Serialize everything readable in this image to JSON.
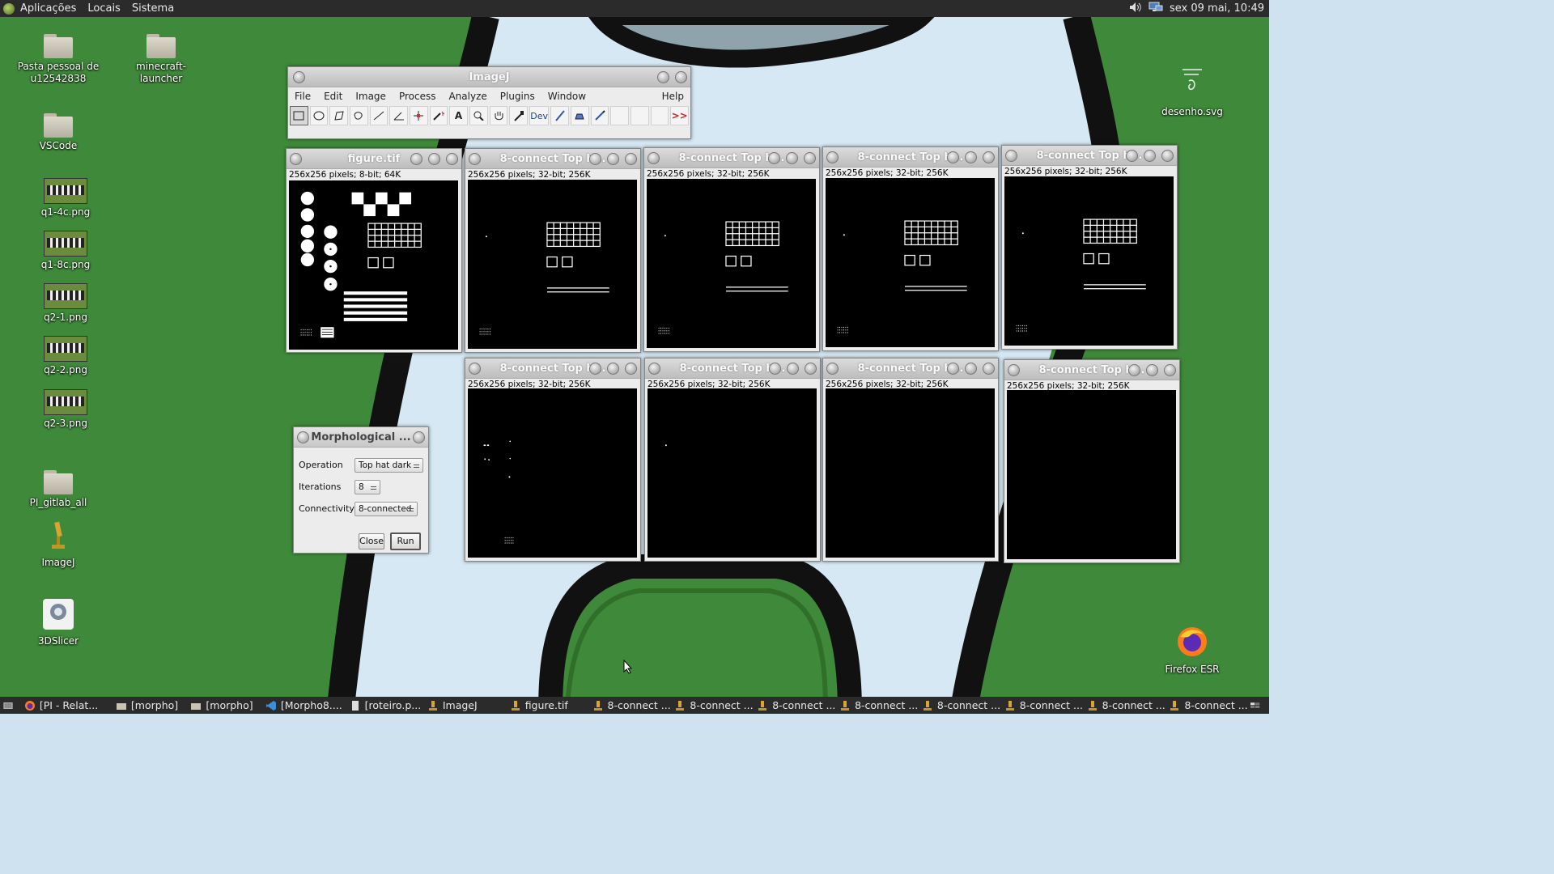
{
  "top_panel": {
    "menus": [
      "Aplicações",
      "Locais",
      "Sistema"
    ],
    "clock": "sex 09 mai, 10:49"
  },
  "desktop_icons": [
    {
      "label": "Pasta pessoal de u12542838",
      "icon": "home-folder-icon"
    },
    {
      "label": "minecraft-launcher",
      "icon": "folder-icon"
    },
    {
      "label": "VSCode",
      "icon": "folder-icon"
    },
    {
      "label": "q1-4c.png",
      "icon": "image-file-icon"
    },
    {
      "label": "q1-8c.png",
      "icon": "image-file-icon"
    },
    {
      "label": "q2-1.png",
      "icon": "image-file-icon"
    },
    {
      "label": "q2-2.png",
      "icon": "image-file-icon"
    },
    {
      "label": "q2-3.png",
      "icon": "image-file-icon"
    },
    {
      "label": "PI_gitlab_all",
      "icon": "folder-icon"
    },
    {
      "label": "ImageJ",
      "icon": "microscope-icon"
    },
    {
      "label": "3DSlicer",
      "icon": "slicer-icon"
    },
    {
      "label": "desenho.svg",
      "icon": "svg-file-icon"
    },
    {
      "label": "Firefox ESR",
      "icon": "firefox-icon"
    }
  ],
  "imagej": {
    "title": "ImageJ",
    "menus": [
      "File",
      "Edit",
      "Image",
      "Process",
      "Analyze",
      "Plugins",
      "Window",
      "Help"
    ],
    "dev_label": "Dev",
    "more_tools": ">>"
  },
  "image_windows": [
    {
      "title": "figure.tif",
      "info": "256x256 pixels; 8-bit; 64K"
    },
    {
      "title": "8-connect Top h...",
      "info": "256x256 pixels; 32-bit; 256K"
    },
    {
      "title": "8-connect Top h...",
      "info": "256x256 pixels; 32-bit; 256K"
    },
    {
      "title": "8-connect Top h...",
      "info": "256x256 pixels; 32-bit; 256K"
    },
    {
      "title": "8-connect Top h...",
      "info": "256x256 pixels; 32-bit; 256K"
    },
    {
      "title": "8-connect Top h...",
      "info": "256x256 pixels; 32-bit; 256K"
    },
    {
      "title": "8-connect Top h...",
      "info": "256x256 pixels; 32-bit; 256K"
    },
    {
      "title": "8-connect Top h...",
      "info": "256x256 pixels; 32-bit; 256K"
    },
    {
      "title": "8-connect Top h...",
      "info": "256x256 pixels; 32-bit; 256K"
    }
  ],
  "dialog": {
    "title": "Morphological ...",
    "operation_label": "Operation",
    "operation_value": "Top hat dark",
    "iterations_label": "Iterations",
    "iterations_value": "8",
    "connectivity_label": "Connectivity",
    "connectivity_value": "8-connected",
    "close_label": "Close",
    "run_label": "Run"
  },
  "taskbar": [
    "[PI - Relat...",
    "[morpho]",
    "[morpho]",
    "[Morpho8....",
    "[roteiro.p...",
    "ImageJ",
    "figure.tif",
    "8-connect ...",
    "8-connect ...",
    "8-connect ...",
    "8-connect ...",
    "8-connect ...",
    "8-connect ...",
    "8-connect ...",
    "8-connect ..."
  ]
}
